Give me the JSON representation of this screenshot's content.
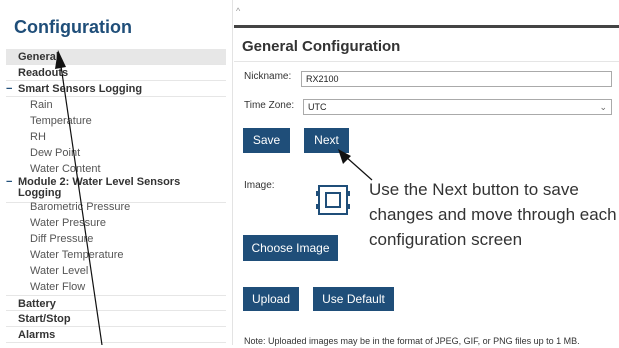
{
  "sidebar": {
    "title": "Configuration",
    "general": "General",
    "readouts": "Readouts",
    "smart_sensors": {
      "label": "Smart Sensors Logging",
      "items": [
        "Rain",
        "Temperature",
        "RH",
        "Dew Point",
        "Water Content"
      ]
    },
    "module2": {
      "label": "Module 2: Water Level Sensors Logging",
      "items": [
        "Barometric Pressure",
        "Water Pressure",
        "Diff Pressure",
        "Water Temperature",
        "Water Level",
        "Water Flow"
      ]
    },
    "battery": "Battery",
    "start_stop": "Start/Stop",
    "alarms": "Alarms"
  },
  "main": {
    "title": "General Configuration",
    "nickname_label": "Nickname:",
    "nickname_value": "RX2100",
    "timezone_label": "Time Zone:",
    "timezone_value": "UTC",
    "save_label": "Save",
    "next_label": "Next",
    "image_label": "Image:",
    "choose_image_label": "Choose Image",
    "upload_label": "Upload",
    "use_default_label": "Use Default",
    "note": "Note: Uploaded images may be in the format of JPEG, GIF, or PNG files up to 1 MB."
  },
  "annotation": "Use the Next button to save changes and move through each configuration screen",
  "colors": {
    "accent": "#1f4e79",
    "button": "#1f4e79"
  }
}
